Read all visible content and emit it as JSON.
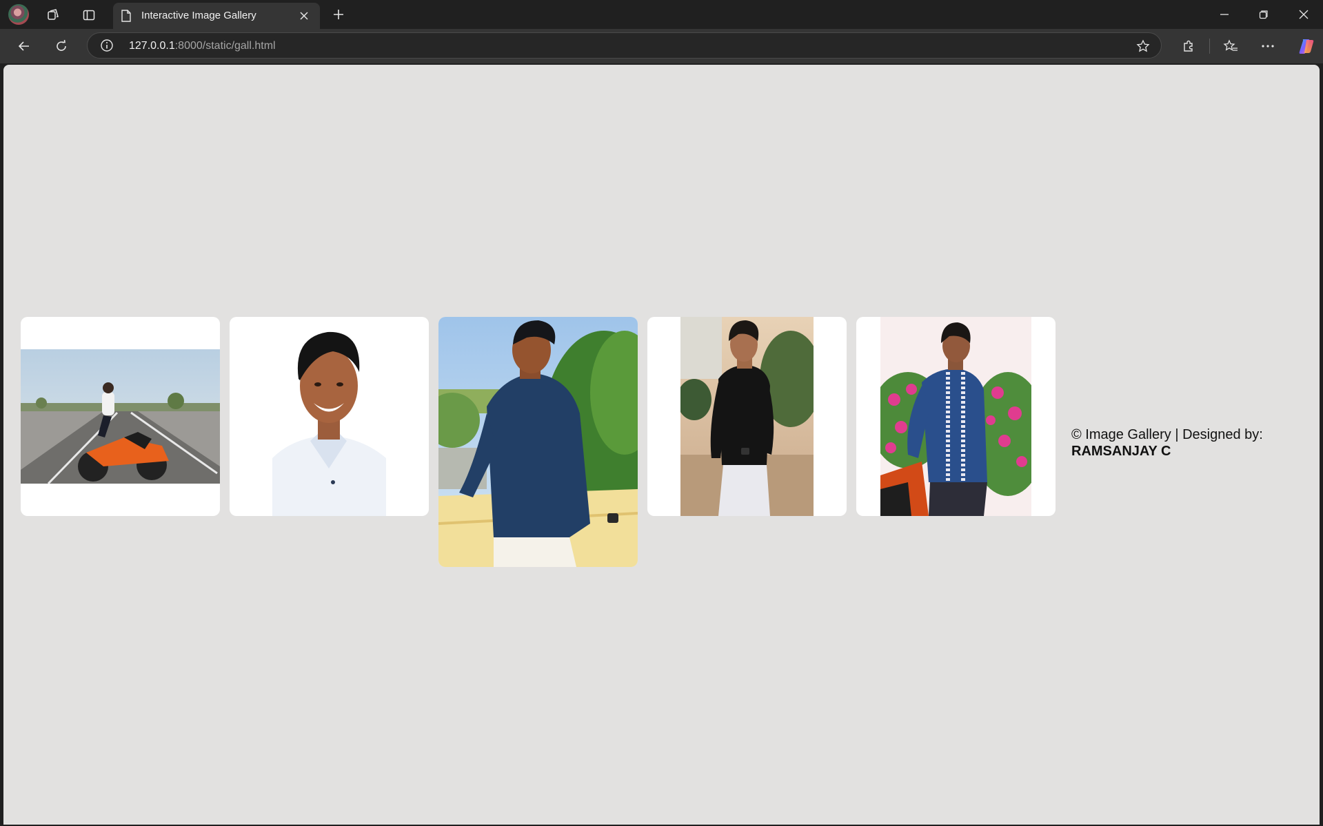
{
  "browser": {
    "tab": {
      "title": "Interactive Image Gallery"
    },
    "address": {
      "host": "127.0.0.1",
      "path": ":8000/static/gall.html"
    },
    "icons": {
      "profile": "profile-avatar-icon",
      "workspaces": "workspaces-icon",
      "tab_actions": "vertical-tabs-icon",
      "new_tab": "plus-icon",
      "back": "back-arrow-icon",
      "refresh": "refresh-icon",
      "site_info": "info-icon",
      "favorite": "star-icon",
      "extensions": "puzzle-icon",
      "favorites": "favorites-icon",
      "menu": "more-icon",
      "copilot": "copilot-icon"
    }
  },
  "gallery": {
    "images": [
      {
        "alt": "Young man posing on orange motorcycle on road",
        "name": "photo-motorcycle"
      },
      {
        "alt": "Smiling portrait in white shirt",
        "name": "photo-portrait-white"
      },
      {
        "alt": "Young man in blue shirt leaning on wall",
        "name": "photo-blue-shirt"
      },
      {
        "alt": "Young man in black shirt with watch",
        "name": "photo-black-shirt"
      },
      {
        "alt": "Young man in embroidered shirt near flowers",
        "name": "photo-flowers"
      }
    ]
  },
  "footer": {
    "text": "© Image Gallery | Designed by:",
    "designer": "RAMSANJAY C"
  }
}
